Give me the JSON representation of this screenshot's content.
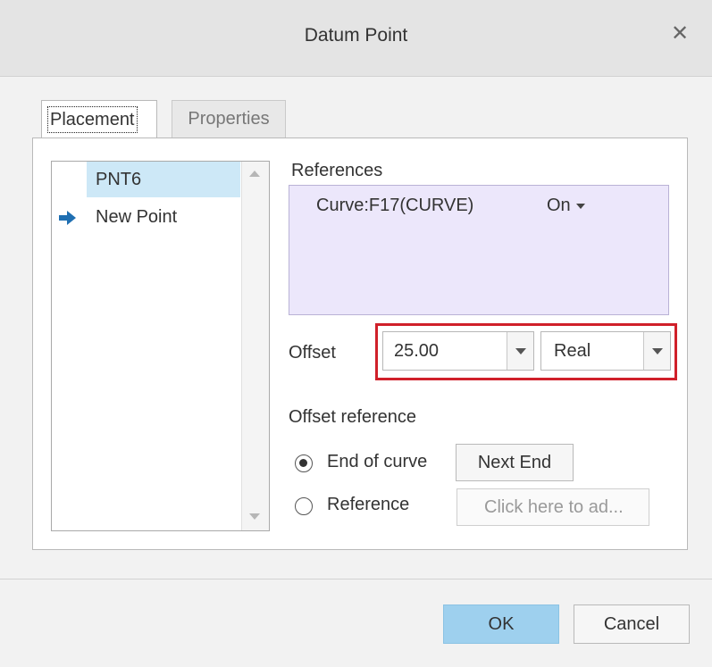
{
  "dialog": {
    "title": "Datum Point"
  },
  "tabs": [
    {
      "label": "Placement",
      "active": true
    },
    {
      "label": "Properties",
      "active": false
    }
  ],
  "point_list": {
    "items": [
      {
        "label": "PNT6",
        "selected": true
      },
      {
        "label": "New Point",
        "current": true,
        "icon": "arrow-right-icon"
      }
    ]
  },
  "references": {
    "label": "References",
    "items": [
      {
        "name": "Curve:F17(CURVE)",
        "constraint": "On"
      }
    ]
  },
  "offset": {
    "label": "Offset",
    "value": "25.00",
    "type": "Real"
  },
  "offset_reference": {
    "label": "Offset reference",
    "end_of_curve": {
      "label": "End of curve",
      "checked": true,
      "button": "Next End"
    },
    "reference": {
      "label": "Reference",
      "checked": false,
      "placeholder": "Click here to ad..."
    }
  },
  "footer": {
    "ok": "OK",
    "cancel": "Cancel"
  },
  "colors": {
    "selection": "#cde8f7",
    "references_bg": "#ece7fb",
    "highlight": "#d0202a",
    "ok_button": "#9ed0ee",
    "arrow": "#1f6fb2"
  }
}
